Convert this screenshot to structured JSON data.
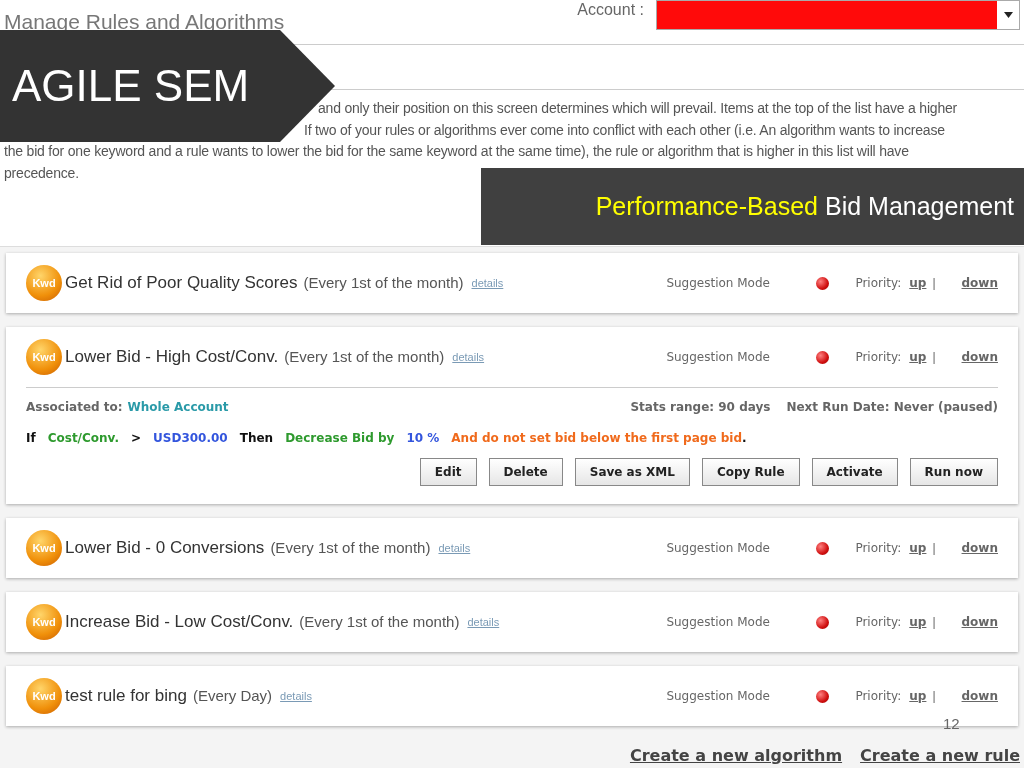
{
  "header": {
    "title": "Manage Rules and Algorithms",
    "account_label": "Account :"
  },
  "priority": {
    "lines": [
      "and only their position on this screen determines which will prevail. Items at the top of the list have a higher",
      "If two of your rules or algorithms ever come into conflict with each other (i.e. An algorithm wants to increase",
      "the bid for one keyword and a rule wants to lower the bid for the same keyword at the same time), the rule or algorithm that is higher in this list will have",
      "precedence."
    ]
  },
  "rules": [
    {
      "badge": "Kwd",
      "name": "Get Rid of Poor Quality Scores",
      "schedule": "(Every 1st of the month)",
      "details": "details",
      "mode": "Suggestion Mode",
      "priority_label": "Priority:",
      "up": "up",
      "separator": "|",
      "down": "down"
    },
    {
      "badge": "Kwd",
      "name": "Lower Bid - High Cost/Conv.",
      "schedule": "(Every 1st of the month)",
      "details": "details",
      "mode": "Suggestion Mode",
      "priority_label": "Priority:",
      "up": "up",
      "separator": "|",
      "down": "down",
      "detail": {
        "associated_label": "Associated to:",
        "associated_value": "Whole Account",
        "stats": "Stats range: 90 days",
        "next_run": "Next Run Date: Never (paused)",
        "condition": [
          {
            "text": "If",
            "kind": "keyword"
          },
          {
            "text": "Cost/Conv.",
            "kind": "metric"
          },
          {
            "text": ">",
            "kind": "keyword"
          },
          {
            "text": "USD300.00",
            "kind": "amount"
          },
          {
            "text": "Then",
            "kind": "keyword"
          },
          {
            "text": "Decrease Bid by",
            "kind": "metric"
          },
          {
            "text": "10 %",
            "kind": "amount"
          },
          {
            "text": "And do not set bid below the first page bid",
            "kind": "note"
          },
          {
            "text": ".",
            "kind": "keyword"
          }
        ],
        "buttons": [
          "Edit",
          "Delete",
          "Save as XML",
          "Copy Rule",
          "Activate",
          "Run now"
        ]
      }
    },
    {
      "badge": "Kwd",
      "name": "Lower Bid - 0 Conversions",
      "schedule": "(Every 1st of the month)",
      "details": "details",
      "mode": "Suggestion Mode",
      "priority_label": "Priority:",
      "up": "up",
      "separator": "|",
      "down": "down"
    },
    {
      "badge": "Kwd",
      "name": "Increase Bid - Low Cost/Conv.",
      "schedule": "(Every 1st of the month)",
      "details": "details",
      "mode": "Suggestion Mode",
      "priority_label": "Priority:",
      "up": "up",
      "separator": "|",
      "down": "down"
    },
    {
      "badge": "Kwd",
      "name": "test rule for bing",
      "schedule": "(Every Day)",
      "details": "details",
      "mode": "Suggestion Mode",
      "priority_label": "Priority:",
      "up": "up",
      "separator": "|",
      "down": "down"
    }
  ],
  "footer_links": [
    "Create a new algorithm",
    "Create a new rule"
  ],
  "slide": {
    "banner": "AGILE SEM",
    "subtitle_highlight": "Performance-Based",
    "subtitle": "Bid Management",
    "page_number": "12"
  }
}
